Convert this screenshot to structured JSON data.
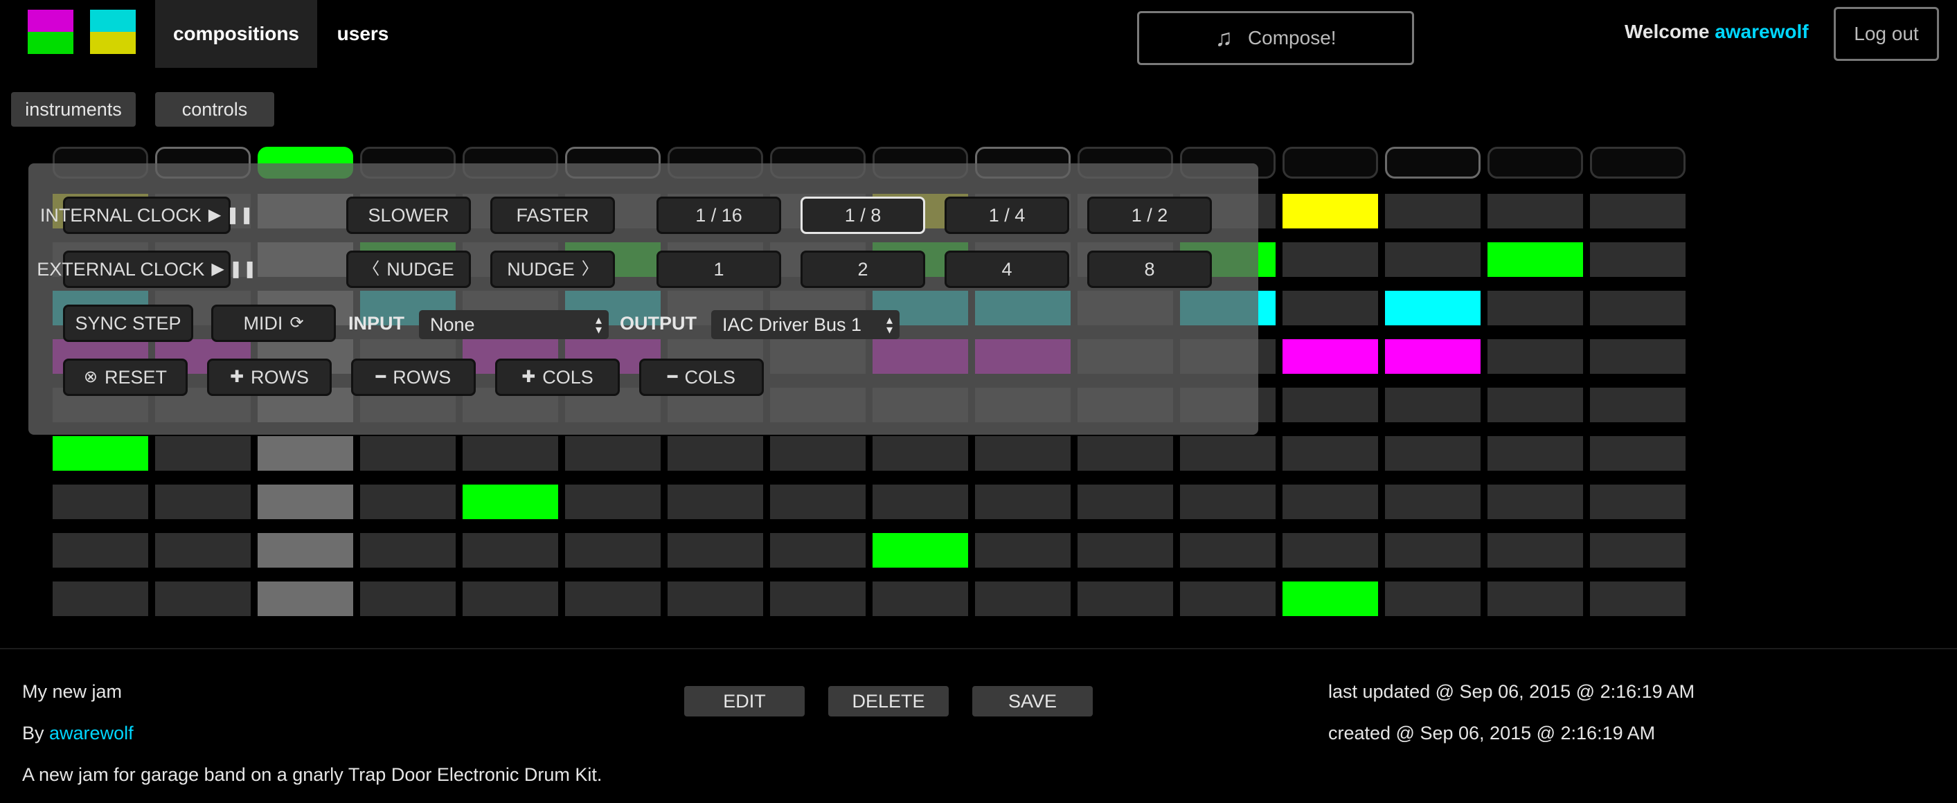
{
  "nav": {
    "tabs": [
      {
        "label": "compositions",
        "active": true
      },
      {
        "label": "users",
        "active": false
      }
    ],
    "compose_label": "Compose!",
    "compose_icon": "music-note-icon",
    "welcome_text": "Welcome",
    "username": "awarewolf",
    "logout_label": "Log out",
    "logo_colors": {
      "left": [
        "#d400d4",
        "#d400d4",
        "#00dd00",
        "#00dd00"
      ],
      "right": [
        "#00d8d8",
        "#00d8d8",
        "#d4d400",
        "#d4d400"
      ]
    }
  },
  "subtabs": [
    "instruments",
    "controls"
  ],
  "sequencer": {
    "columns": 16,
    "rows": 9,
    "active_step": 2,
    "step_indicator_light": [
      1,
      5,
      9,
      13
    ],
    "colors": {
      "off": "#2f2f2f",
      "highlight_column": "#6e6e6e",
      "green": "#00ff00",
      "yellow": "#ffff00",
      "cyan": "#00ffff",
      "magenta": "#ff00ff"
    },
    "row_colors": [
      "yellow",
      "green",
      "cyan",
      "magenta",
      "green",
      "green",
      "green",
      "green",
      "green"
    ],
    "active_cells": [
      [
        0,
        0
      ],
      [
        0,
        8
      ],
      [
        0,
        12
      ],
      [
        1,
        3
      ],
      [
        1,
        5
      ],
      [
        1,
        8
      ],
      [
        1,
        11
      ],
      [
        1,
        14
      ],
      [
        2,
        0
      ],
      [
        2,
        3
      ],
      [
        2,
        5
      ],
      [
        2,
        8
      ],
      [
        2,
        9
      ],
      [
        2,
        11
      ],
      [
        2,
        13
      ],
      [
        3,
        0
      ],
      [
        3,
        1
      ],
      [
        3,
        4
      ],
      [
        3,
        5
      ],
      [
        3,
        8
      ],
      [
        3,
        9
      ],
      [
        3,
        12
      ],
      [
        3,
        13
      ],
      [
        5,
        0
      ],
      [
        6,
        4
      ],
      [
        7,
        8
      ],
      [
        8,
        12
      ]
    ]
  },
  "controls": {
    "internal_clock": "INTERNAL CLOCK",
    "external_clock": "EXTERNAL CLOCK",
    "slower": "SLOWER",
    "faster": "FASTER",
    "nudge_back": "NUDGE",
    "nudge_forward": "NUDGE",
    "divisions": [
      "1 / 16",
      "1 / 8",
      "1 / 4",
      "1 / 2"
    ],
    "selected_division": "1 / 8",
    "multipliers": [
      "1",
      "2",
      "4",
      "8"
    ],
    "sync_step": "SYNC STEP",
    "midi": "MIDI",
    "input_label": "INPUT",
    "input_value": "None",
    "output_label": "OUTPUT",
    "output_value": "IAC Driver Bus 1",
    "reset": "RESET",
    "add_rows": "ROWS",
    "remove_rows": "ROWS",
    "add_cols": "COLS",
    "remove_cols": "COLS"
  },
  "composition": {
    "title": "My new jam",
    "by_label": "By",
    "author": "awarewolf",
    "description": "A new jam for garage band on a gnarly Trap Door Electronic Drum Kit.",
    "last_updated": "last updated @ Sep 06, 2015 @ 2:16:19 AM",
    "created": "created @ Sep 06, 2015 @ 2:16:19 AM",
    "buttons": [
      "EDIT",
      "DELETE",
      "SAVE"
    ]
  }
}
